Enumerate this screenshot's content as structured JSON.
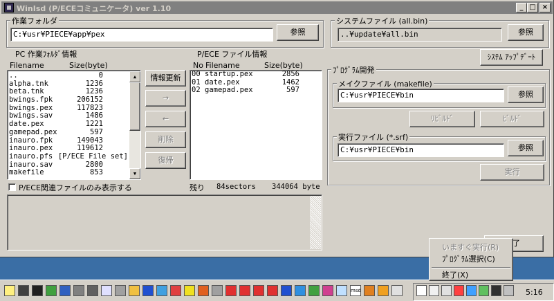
{
  "window": {
    "title": "WinIsd (P/ECEコミュニケータ) ver 1.10",
    "minimize": "_",
    "maximize": "□",
    "close": "×"
  },
  "work_folder": {
    "label": "作業フォルダ",
    "path": "C:¥usr¥PIECE¥app¥pex",
    "browse": "参照"
  },
  "system_file": {
    "label": "システムファイル (all.bin)",
    "path": "..¥update¥all.bin",
    "browse": "参照",
    "update_button": "ｼｽﾃﾑ ｱｯﾌﾟﾃﾞｰﾄ"
  },
  "pc_list": {
    "title": "PC 作業ﾌｫﾙﾀﾞ情報",
    "col_filename": "Filename",
    "col_size": "Size(byte)",
    "rows": [
      {
        "name": "..",
        "size": "0"
      },
      {
        "name": "alpha.tnk",
        "size": "1236"
      },
      {
        "name": "beta.tnk",
        "size": "1236"
      },
      {
        "name": "bwings.fpk",
        "size": "206152"
      },
      {
        "name": "bwings.pex",
        "size": "117823"
      },
      {
        "name": "bwings.sav",
        "size": "1486"
      },
      {
        "name": "date.pex",
        "size": "1221"
      },
      {
        "name": "gamepad.pex",
        "size": "597"
      },
      {
        "name": "inauro.fpk",
        "size": "149043"
      },
      {
        "name": "inauro.pex",
        "size": "119612"
      },
      {
        "name": "inauro.pfs",
        "size": "[P/ECE File set]"
      },
      {
        "name": "inauro.sav",
        "size": "2800"
      },
      {
        "name": "makefile",
        "size": "853"
      }
    ],
    "filter_checkbox": "P/ECE関連ファイルのみ表示する"
  },
  "middle_buttons": {
    "refresh": "情報更新",
    "to_pece": "→",
    "to_pc": "←",
    "delete": "削除",
    "restore": "復帰"
  },
  "pece_list": {
    "title": "P/ECE ファイル情報",
    "col_no": "No",
    "col_filename": "Filename",
    "col_size": "Size(byte)",
    "rows": [
      {
        "no": "00",
        "name": "startup.pex",
        "size": "2856"
      },
      {
        "no": "01",
        "name": "date.pex",
        "size": "1462"
      },
      {
        "no": "02",
        "name": "gamepad.pex",
        "size": "597"
      }
    ],
    "remaining_label": "残り",
    "remaining_sectors": "84sectors",
    "remaining_bytes": "344064 byte"
  },
  "program_dev": {
    "label": "ﾌﾟﾛｸﾞﾗﾑ開発",
    "makefile_label": "メイクファイル (makefile)",
    "makefile_path": "C:¥usr¥PIECE¥bin",
    "makefile_browse": "参照",
    "rebuild": "ﾘﾋﾞﾙﾄﾞ",
    "build": "ﾋﾞﾙﾄﾞ",
    "exec_label": "実行ファイル (*.srf)",
    "exec_path": "C:¥usr¥PIECE¥bin",
    "exec_browse": "参照",
    "run": "実行"
  },
  "close_button_partial": "了",
  "context_menu": {
    "items": [
      {
        "label": "いますぐ実行(R)",
        "disabled": true
      },
      {
        "label": "ﾌﾟﾛｸﾞﾗﾑ選択(C)",
        "disabled": false
      },
      {
        "label": "終了(X)",
        "disabled": false
      }
    ]
  },
  "taskbar": {
    "clock": "5:16",
    "msdn_label": "msdn"
  }
}
